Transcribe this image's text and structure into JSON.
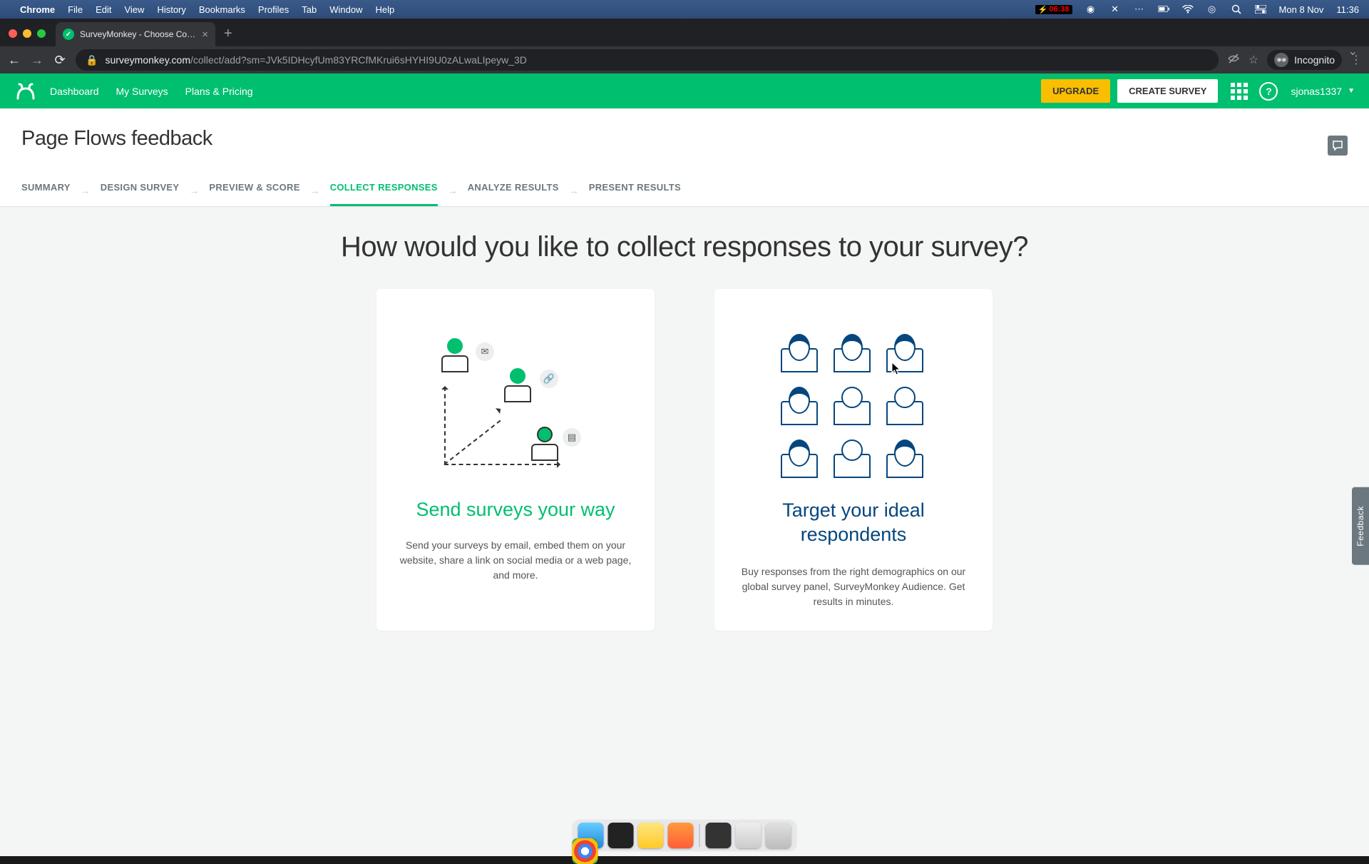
{
  "mac_menu": {
    "app": "Chrome",
    "items": [
      "File",
      "Edit",
      "View",
      "History",
      "Bookmarks",
      "Profiles",
      "Tab",
      "Window",
      "Help"
    ],
    "battery_indicator": "06:38",
    "date": "Mon 8 Nov",
    "time": "11:36"
  },
  "browser": {
    "tab_title": "SurveyMonkey - Choose Collec",
    "url_host": "surveymonkey.com",
    "url_path": "/collect/add?sm=JVk5IDHcyfUm83YRCfMKrui6sHYHI9U0zALwaLIpeyw_3D",
    "incognito_label": "Incognito"
  },
  "nav": {
    "links": [
      "Dashboard",
      "My Surveys",
      "Plans & Pricing"
    ],
    "upgrade": "UPGRADE",
    "create": "CREATE SURVEY",
    "help": "?",
    "username": "sjonas1337"
  },
  "page": {
    "title": "Page Flows feedback",
    "steps": [
      "SUMMARY",
      "DESIGN SURVEY",
      "PREVIEW & SCORE",
      "COLLECT RESPONSES",
      "ANALYZE RESULTS",
      "PRESENT RESULTS"
    ],
    "active_step_index": 3,
    "heading": "How would you like to collect responses to your survey?",
    "card_left": {
      "title": "Send surveys your way",
      "body": "Send your surveys by email, embed them on your website, share a link on social media or a web page, and more."
    },
    "card_right": {
      "title": "Target your ideal respondents",
      "body": "Buy responses from the right demographics on our global survey panel, SurveyMonkey Audience. Get results in minutes."
    },
    "feedback_tab": "Feedback"
  },
  "colors": {
    "brand_green": "#00bf6f",
    "brand_yellow": "#f9be00",
    "brand_navy": "#05467e"
  }
}
